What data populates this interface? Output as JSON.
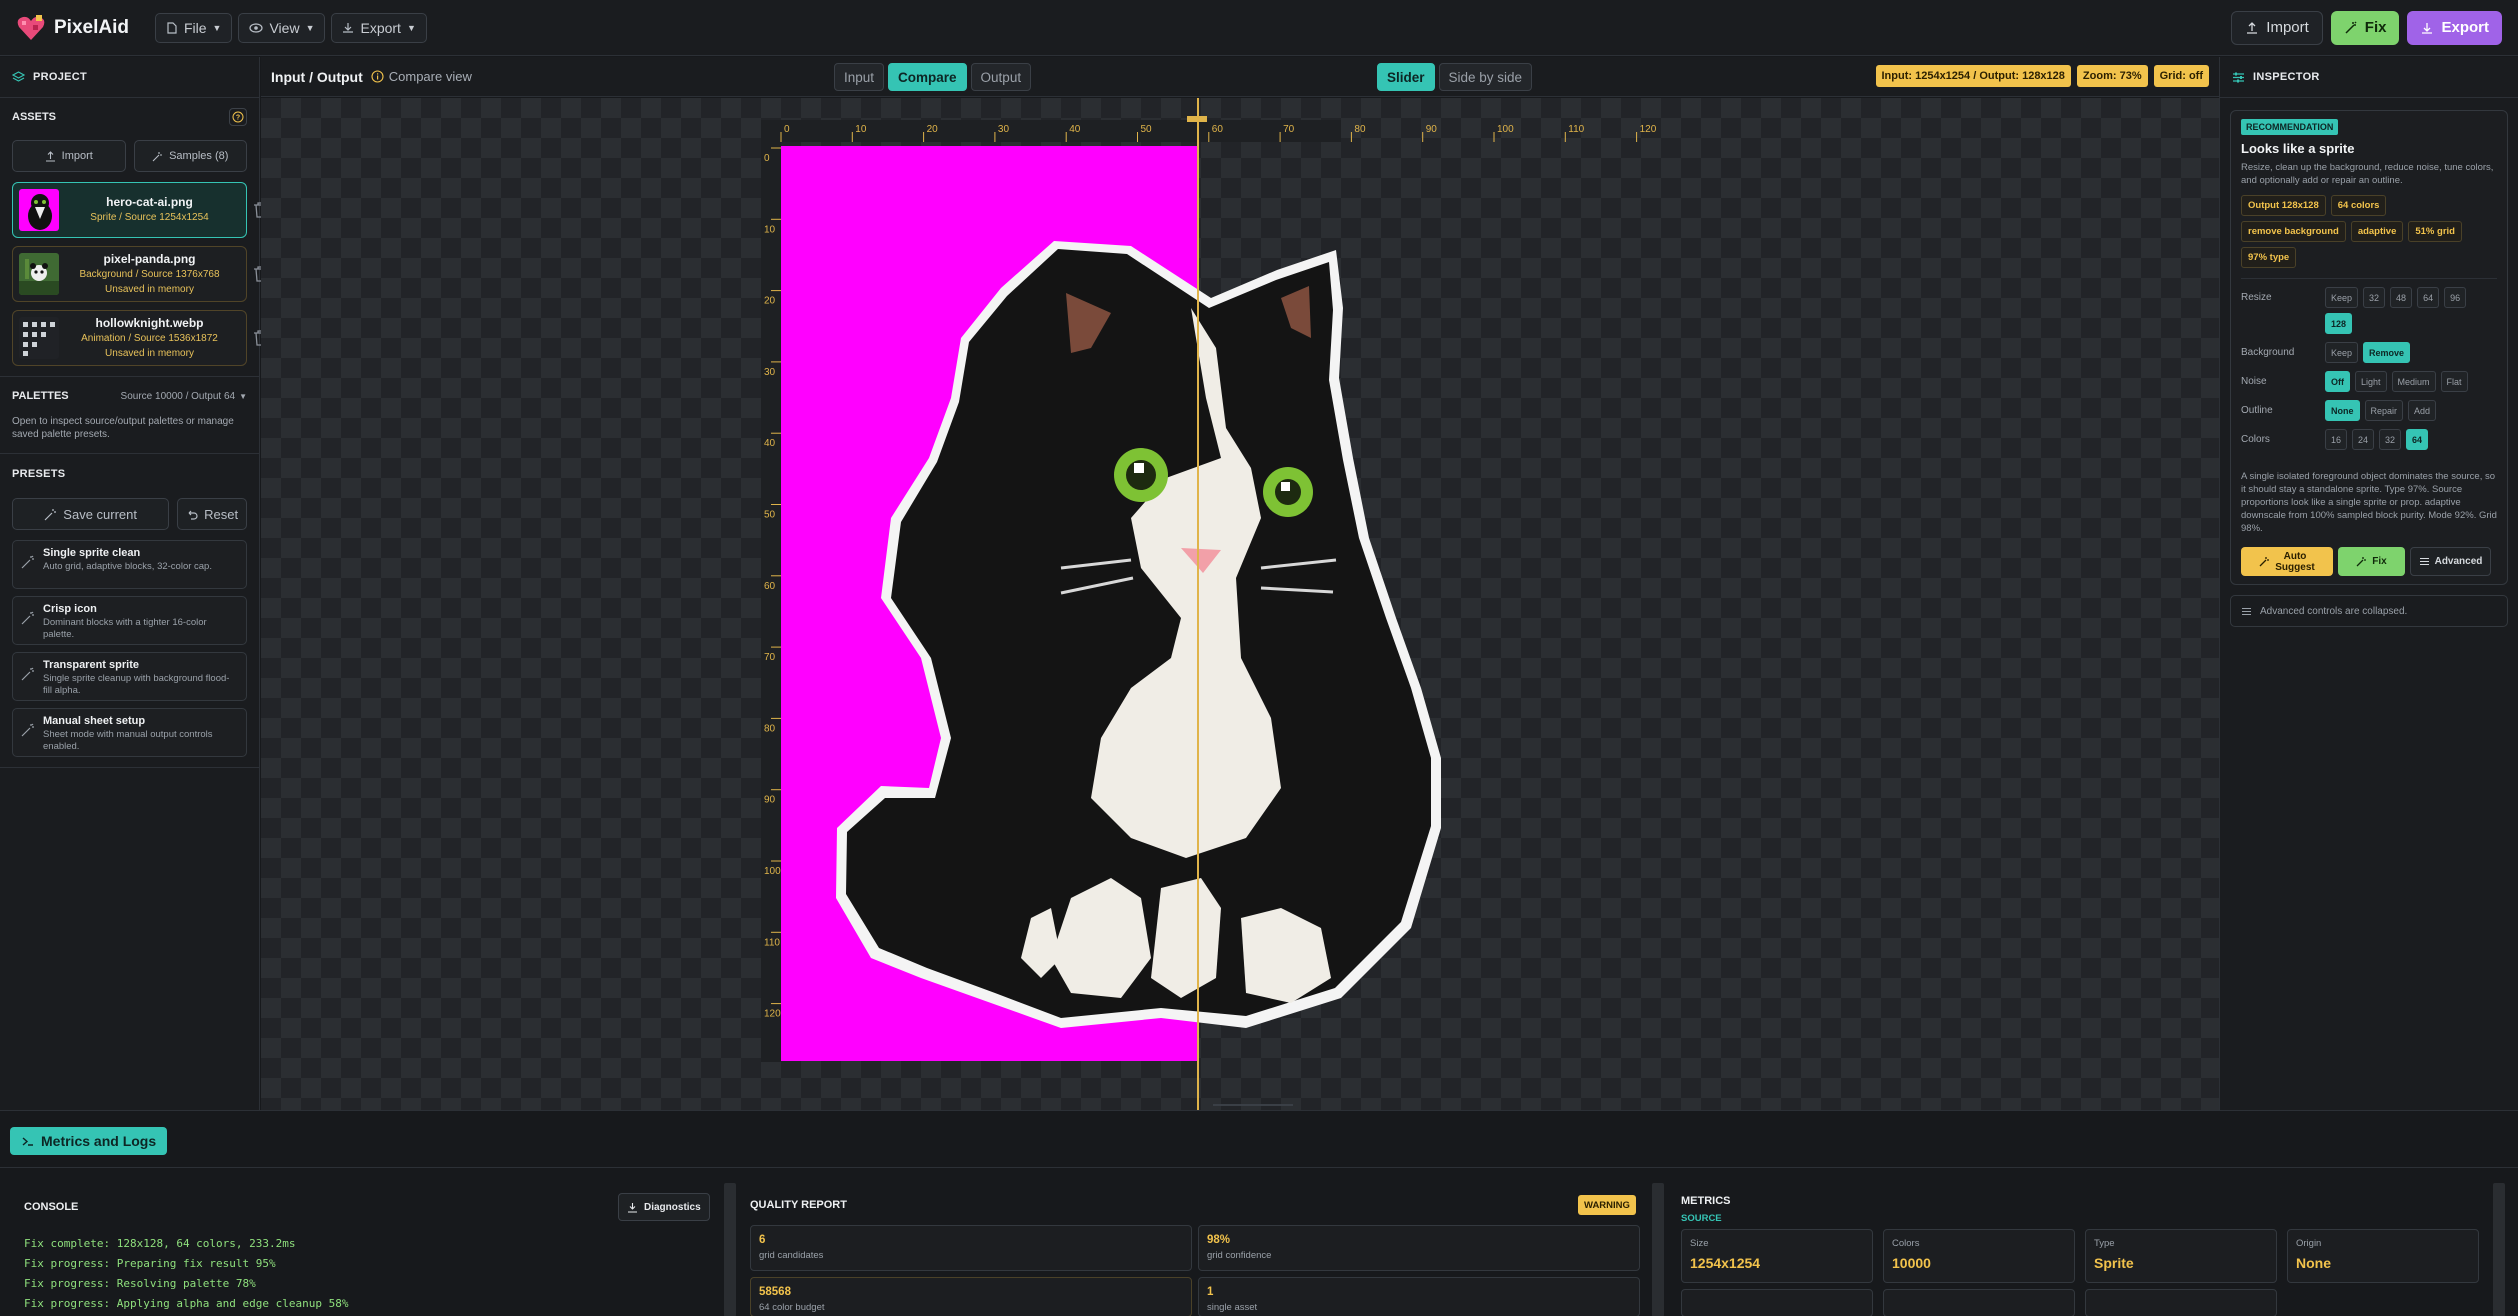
{
  "app": {
    "name": "PixelAid"
  },
  "menu": {
    "file": "File",
    "view": "View",
    "export": "Export"
  },
  "toolbar": {
    "import": "Import",
    "fix": "Fix",
    "export": "Export"
  },
  "sidebar": {
    "project": "PROJECT",
    "assets": "ASSETS",
    "import_btn": "Import",
    "samples_btn": "Samples (8)",
    "assets_list": [
      {
        "name": "hero-cat-ai.png",
        "sub": "Sprite / Source 1254x1254",
        "note": ""
      },
      {
        "name": "pixel-panda.png",
        "sub": "Background / Source 1376x768",
        "note": "Unsaved in memory"
      },
      {
        "name": "hollowknight.webp",
        "sub": "Animation / Source 1536x1872",
        "note": "Unsaved in memory"
      }
    ],
    "palettes": "PALETTES",
    "palettes_meta": "Source 10000 / Output 64",
    "palettes_desc": "Open to inspect source/output palettes or manage saved palette presets.",
    "presets": "PRESETS",
    "save_current": "Save current",
    "reset": "Reset",
    "presets_list": [
      {
        "title": "Single sprite clean",
        "desc": "Auto grid, adaptive blocks, 32-color cap."
      },
      {
        "title": "Crisp icon",
        "desc": "Dominant blocks with a tighter 16-color palette."
      },
      {
        "title": "Transparent sprite",
        "desc": "Single sprite cleanup with background flood-fill alpha."
      },
      {
        "title": "Manual sheet setup",
        "desc": "Sheet mode with manual output controls enabled."
      }
    ]
  },
  "viewer": {
    "title": "Input / Output",
    "compare_view": "Compare view",
    "mode_tabs": [
      "Input",
      "Compare",
      "Output"
    ],
    "active_mode": "Compare",
    "compare_tabs": [
      "Slider",
      "Side by side"
    ],
    "active_compare": "Slider",
    "badges": [
      "Input: 1254x1254 / Output: 128x128",
      "Zoom: 73%",
      "Grid: off"
    ],
    "ruler_x": [
      "0",
      "10",
      "20",
      "30",
      "40",
      "50",
      "60",
      "70",
      "80",
      "90",
      "100",
      "110",
      "120"
    ],
    "ruler_y": [
      "0",
      "10",
      "20",
      "30",
      "40",
      "50",
      "60",
      "70",
      "80",
      "90",
      "100",
      "110",
      "120"
    ],
    "slider_position": 0.5
  },
  "inspector": {
    "title": "INSPECTOR",
    "rec_tag": "RECOMMENDATION",
    "rec_title": "Looks like a sprite",
    "rec_desc": "Resize, clean up the background, reduce noise, tune colors, and optionally add or repair an outline.",
    "chips": [
      "Output 128x128",
      "64 colors",
      "remove background",
      "adaptive",
      "51% grid",
      "97% type"
    ],
    "controls": [
      {
        "label": "Resize",
        "options": [
          "Keep",
          "32",
          "48",
          "64",
          "96",
          "128"
        ],
        "active": "128"
      },
      {
        "label": "Background",
        "options": [
          "Keep",
          "Remove"
        ],
        "active": "Remove"
      },
      {
        "label": "Noise",
        "options": [
          "Off",
          "Light",
          "Medium",
          "Flat"
        ],
        "active": "Off"
      },
      {
        "label": "Outline",
        "options": [
          "None",
          "Repair",
          "Add"
        ],
        "active": "None"
      },
      {
        "label": "Colors",
        "options": [
          "16",
          "24",
          "32",
          "64"
        ],
        "active": "64"
      }
    ],
    "desc": "A single isolated foreground object dominates the source, so it should stay a standalone sprite. Type 97%. Source proportions look like a single sprite or prop. adaptive downscale from 100% sampled block purity. Mode 92%. Grid 98%.",
    "auto_suggest": "Auto Suggest",
    "fix": "Fix",
    "advanced": "Advanced",
    "collapsed": "Advanced controls are collapsed."
  },
  "bottom": {
    "metrics_logs": "Metrics and Logs",
    "console_title": "CONSOLE",
    "diagnostics": "Diagnostics",
    "logs": [
      "Fix complete: 128x128, 64 colors, 233.2ms",
      "Fix progress: Preparing fix result 95%",
      "Fix progress: Resolving palette 78%",
      "Fix progress: Applying alpha and edge cleanup 58%"
    ],
    "quality_title": "QUALITY REPORT",
    "warning": "WARNING",
    "quality": [
      {
        "value": "6",
        "label": "grid candidates"
      },
      {
        "value": "98%",
        "label": "grid confidence"
      },
      {
        "value": "58568",
        "label": "64 color budget"
      },
      {
        "value": "1",
        "label": "single asset"
      }
    ],
    "metrics_title": "METRICS",
    "metrics_sub": "SOURCE",
    "metrics": [
      {
        "label": "Size",
        "value": "1254x1254"
      },
      {
        "label": "Colors",
        "value": "10000"
      },
      {
        "label": "Type",
        "value": "Sprite"
      },
      {
        "label": "Origin",
        "value": "None"
      }
    ]
  },
  "colors": {
    "accent": "#35c4b4",
    "warn": "#f2c34c",
    "fix": "#7ed36d",
    "export": "#a063e8",
    "magenta": "#ff00ff"
  }
}
